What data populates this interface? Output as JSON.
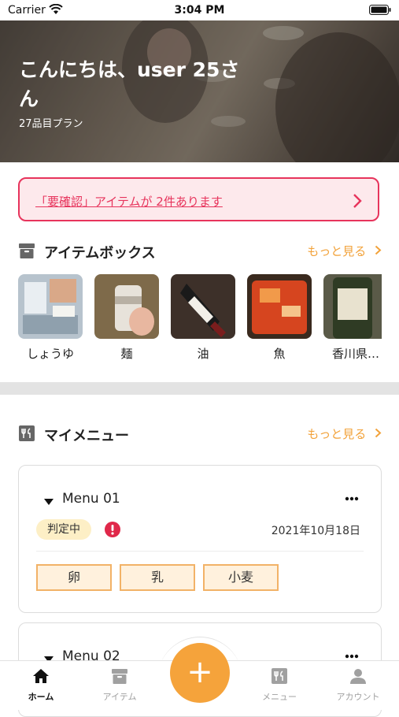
{
  "status_bar": {
    "carrier": "Carrier",
    "time": "3:04 PM"
  },
  "hero": {
    "greeting": "こんにちは、user 25さん",
    "plan": "27品目プラン"
  },
  "alert": {
    "text": "「要確認」アイテムが 2件あります",
    "color": "#e7345c"
  },
  "items_section": {
    "title": "アイテムボックス",
    "more": "もっと見る",
    "items": [
      {
        "label": "しょうゆ"
      },
      {
        "label": "麺"
      },
      {
        "label": "油"
      },
      {
        "label": "魚"
      },
      {
        "label": "香川県…"
      }
    ]
  },
  "menu_section": {
    "title": "マイメニュー",
    "more": "もっと見る",
    "menus": [
      {
        "name": "Menu 01",
        "status": "判定中",
        "date": "2021年10月18日",
        "allergens": [
          "卵",
          "乳",
          "小麦"
        ]
      },
      {
        "name": "Menu 02"
      }
    ]
  },
  "tabbar": {
    "home": "ホーム",
    "items": "アイテム",
    "add": "+",
    "menu": "メニュー",
    "account": "アカウント",
    "active_color": "#111111",
    "inactive_color": "#a0a0a0"
  },
  "colors": {
    "accent": "#f5a33b",
    "alert": "#e7345c",
    "badge_bg": "#fdefc6"
  }
}
